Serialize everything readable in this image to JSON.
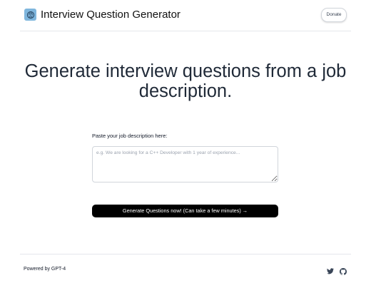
{
  "header": {
    "logo_icon": "brain-icon",
    "title": "Interview Question Generator",
    "donate_label": "Donate"
  },
  "main": {
    "headline": "Generate interview questions from a job description.",
    "prompt_label": "Paste your job description here:",
    "input": {
      "placeholder": "e.g. We are looking for a C++ Developer with 1 year of experience...",
      "value": ""
    },
    "generate_label": "Generate Questions now! (Can take a few minutes) →"
  },
  "footer": {
    "powered_by": "Powered by GPT-4",
    "social_icons": [
      "twitter-icon",
      "github-icon"
    ]
  },
  "colors": {
    "button_bg": "#000000",
    "logo_bg": "#7fb6dd",
    "divider": "#e5e7eb"
  }
}
